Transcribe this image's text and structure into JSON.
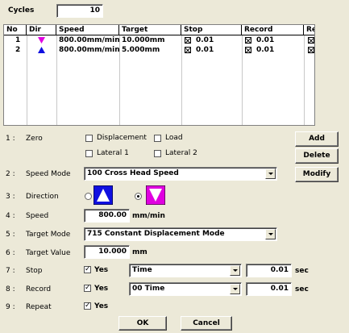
{
  "cycles": {
    "label": "Cycles",
    "value": "10"
  },
  "table": {
    "columns": [
      "No",
      "Dir",
      "Speed",
      "Target",
      "Stop",
      "Record",
      "Repeat"
    ],
    "rows": [
      {
        "no": "1",
        "dir": "down",
        "speed": "800.00mm/min",
        "target": "10.000mm",
        "stop": "0.01",
        "record": "0.01"
      },
      {
        "no": "2",
        "dir": "up",
        "speed": "800.00mm/min",
        "target": "5.000mm",
        "stop": "0.01",
        "record": "0.01"
      }
    ]
  },
  "zero": {
    "num": "1 :",
    "label": "Zero",
    "options": [
      "Displacement",
      "Load",
      "Lateral 1",
      "Lateral 2"
    ]
  },
  "speed_mode": {
    "num": "2 :",
    "label": "Speed Mode",
    "value": "100 Cross Head Speed"
  },
  "direction": {
    "num": "3 :",
    "label": "Direction",
    "up_color": "#1010e0",
    "down_color": "#e000e0",
    "selected": "down"
  },
  "speed": {
    "num": "4 :",
    "label": "Speed",
    "value": "800.00",
    "unit": "mm/min"
  },
  "target_mode": {
    "num": "5 :",
    "label": "Target Mode",
    "value": "715 Constant Displacement Mode"
  },
  "target_value": {
    "num": "6 :",
    "label": "Target Value",
    "value": "10.000",
    "unit": "mm"
  },
  "stop": {
    "num": "7 :",
    "label": "Stop",
    "check_label": "Yes",
    "select": "Time",
    "value": "0.01",
    "unit": "sec"
  },
  "record": {
    "num": "8 :",
    "label": "Record",
    "check_label": "Yes",
    "select": "00 Time",
    "value": "0.01",
    "unit": "sec"
  },
  "repeat": {
    "num": "9 :",
    "label": "Repeat",
    "check_label": "Yes"
  },
  "buttons": {
    "add": "Add",
    "delete": "Delete",
    "modify": "Modify",
    "ok": "OK",
    "cancel": "Cancel"
  }
}
